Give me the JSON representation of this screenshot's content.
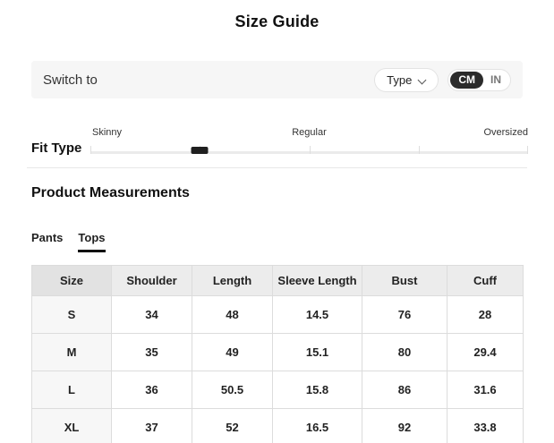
{
  "page": {
    "title": "Size Guide"
  },
  "colors": {
    "accent_dark": "#2b2b2b",
    "bar_bg": "#f6f6f6",
    "header_bg": "#ececec",
    "size_header_bg": "#e2e2e2",
    "size_col_bg": "#f7f7f7",
    "border": "#dcdcdc"
  },
  "switch_bar": {
    "label": "Switch to",
    "type_button": {
      "label": "Type"
    },
    "unit_toggle": {
      "options": [
        "CM",
        "IN"
      ],
      "selected": "CM"
    }
  },
  "fit_type": {
    "label": "Fit Type",
    "options": [
      "Skinny",
      "Regular",
      "Oversized"
    ],
    "selected_percent": 25
  },
  "measurements": {
    "title": "Product Measurements",
    "tabs": [
      {
        "label": "Pants",
        "active": false
      },
      {
        "label": "Tops",
        "active": true
      }
    ],
    "table": {
      "columns": [
        "Size",
        "Shoulder",
        "Length",
        "Sleeve Length",
        "Bust",
        "Cuff"
      ],
      "rows": [
        [
          "S",
          "34",
          "48",
          "14.5",
          "76",
          "28"
        ],
        [
          "M",
          "35",
          "49",
          "15.1",
          "80",
          "29.4"
        ],
        [
          "L",
          "36",
          "50.5",
          "15.8",
          "86",
          "31.6"
        ],
        [
          "XL",
          "37",
          "52",
          "16.5",
          "92",
          "33.8"
        ]
      ]
    }
  }
}
